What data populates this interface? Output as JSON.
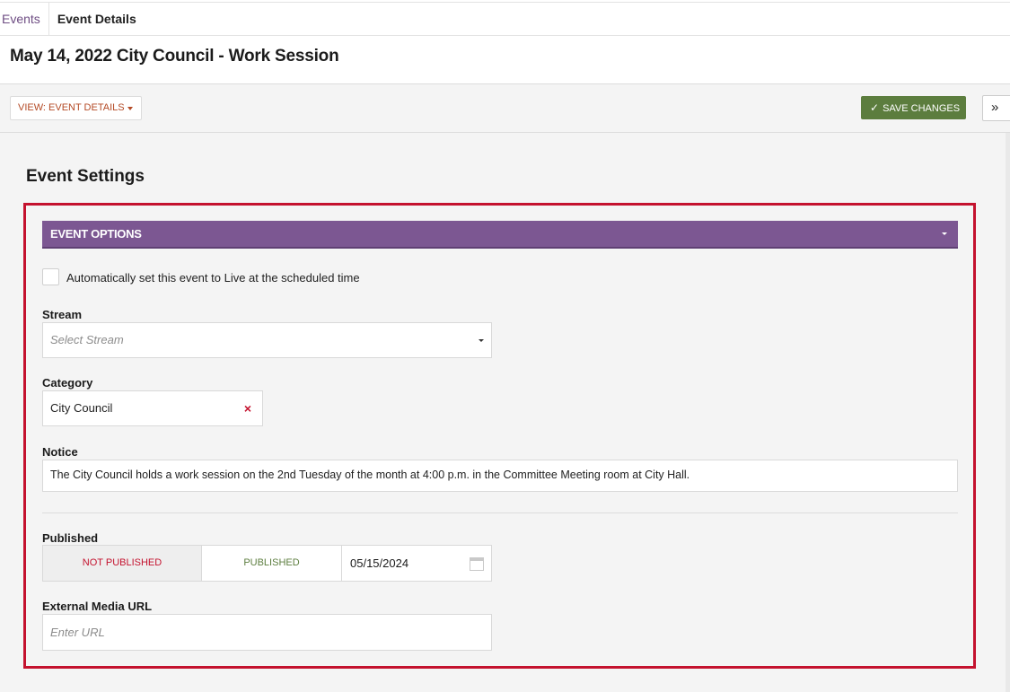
{
  "breadcrumb": {
    "events": "Events",
    "details": "Event Details"
  },
  "page": {
    "title": "May 14, 2022 City Council - Work Session"
  },
  "toolbar": {
    "view_label": "VIEW: EVENT DETAILS",
    "save_label": "SAVE CHANGES",
    "expand_label": "»"
  },
  "settings": {
    "title": "Event Settings",
    "panel_title": "EVENT OPTIONS",
    "auto_live_label": "Automatically set this event to Live at the scheduled time",
    "auto_live_checked": false,
    "stream_label": "Stream",
    "stream_placeholder": "Select Stream",
    "category_label": "Category",
    "category_value": "City Council",
    "category_remove": "×",
    "notice_label": "Notice",
    "notice_value": "The City Council holds a work session on the 2nd Tuesday of the month at  4:00 p.m. in the Committee Meeting room at City Hall.",
    "published_label": "Published",
    "not_published": "NOT PUBLISHED",
    "published": "PUBLISHED",
    "published_date": "05/15/2024",
    "url_label": "External Media URL",
    "url_placeholder": "Enter URL"
  },
  "colors": {
    "accent_purple": "#7c5792",
    "save_green": "#5c7d3e",
    "highlight_red": "#c4122e",
    "view_orange": "#b44a25"
  },
  "icons": {
    "check": "check-icon",
    "expand": "double-chevron-right-icon",
    "calendar": "calendar-icon",
    "remove": "close-icon"
  }
}
